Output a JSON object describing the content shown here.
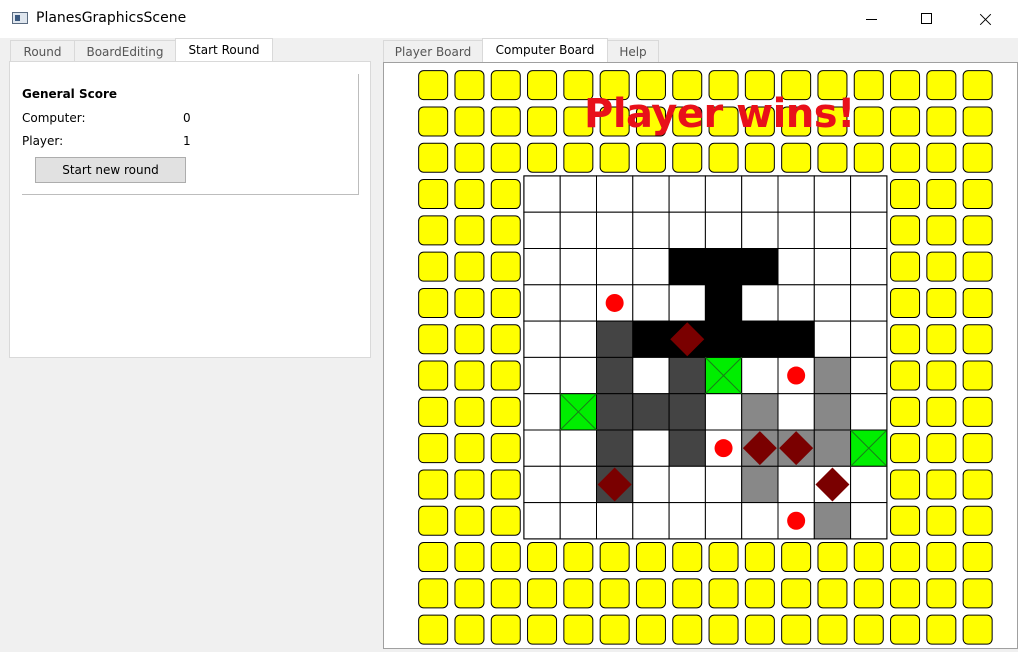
{
  "window": {
    "title": "PlanesGraphicsScene"
  },
  "left_tabs": [
    {
      "label": "Round",
      "active": false
    },
    {
      "label": "BoardEditing",
      "active": false
    },
    {
      "label": "Start Round",
      "active": true
    }
  ],
  "right_tabs": [
    {
      "label": "Player Board",
      "active": false
    },
    {
      "label": "Computer Board",
      "active": true
    },
    {
      "label": "Help",
      "active": false
    }
  ],
  "score": {
    "title": "General Score",
    "computer_label": "Computer:",
    "computer_value": "0",
    "player_label": "Player:",
    "player_value": "1",
    "new_round_button": "Start new round"
  },
  "board": {
    "message": "Player wins!",
    "message_color": "#e8101a",
    "outer_cols": 16,
    "outer_rows": 16,
    "inner_offset": {
      "col": 3,
      "row": 3
    },
    "inner_cols": 10,
    "inner_rows": 10,
    "colors": {
      "padding_cell": "#ffff00",
      "grid_cell": "#ffffff",
      "plane_head": "#000000",
      "plane_dark": "#444444",
      "plane_gray": "#888888",
      "hit": "#00ee00",
      "miss": "#ff0000",
      "diamond": "#7a0000"
    },
    "black_cells": [
      [
        4,
        2
      ],
      [
        5,
        2
      ],
      [
        6,
        2
      ],
      [
        5,
        3
      ],
      [
        3,
        4
      ],
      [
        4,
        4
      ],
      [
        5,
        4
      ],
      [
        6,
        4
      ],
      [
        7,
        4
      ]
    ],
    "dark_cells": [
      [
        2,
        4
      ],
      [
        2,
        5
      ],
      [
        4,
        5
      ],
      [
        2,
        6
      ],
      [
        3,
        6
      ],
      [
        4,
        6
      ],
      [
        2,
        7
      ],
      [
        4,
        7
      ],
      [
        2,
        8
      ]
    ],
    "gray_cells": [
      [
        8,
        5
      ],
      [
        6,
        6
      ],
      [
        8,
        6
      ],
      [
        6,
        7
      ],
      [
        7,
        7
      ],
      [
        8,
        7
      ],
      [
        6,
        8
      ],
      [
        8,
        9
      ]
    ],
    "hit_cells": [
      [
        5,
        5
      ],
      [
        1,
        6
      ],
      [
        9,
        7
      ]
    ],
    "miss_cells": [
      [
        2,
        3
      ],
      [
        7,
        5
      ],
      [
        5,
        7
      ],
      [
        7,
        9
      ]
    ],
    "diamond_cells": [
      [
        4,
        4
      ],
      [
        6,
        7
      ],
      [
        7,
        7
      ],
      [
        2,
        8
      ],
      [
        8,
        8
      ]
    ]
  }
}
